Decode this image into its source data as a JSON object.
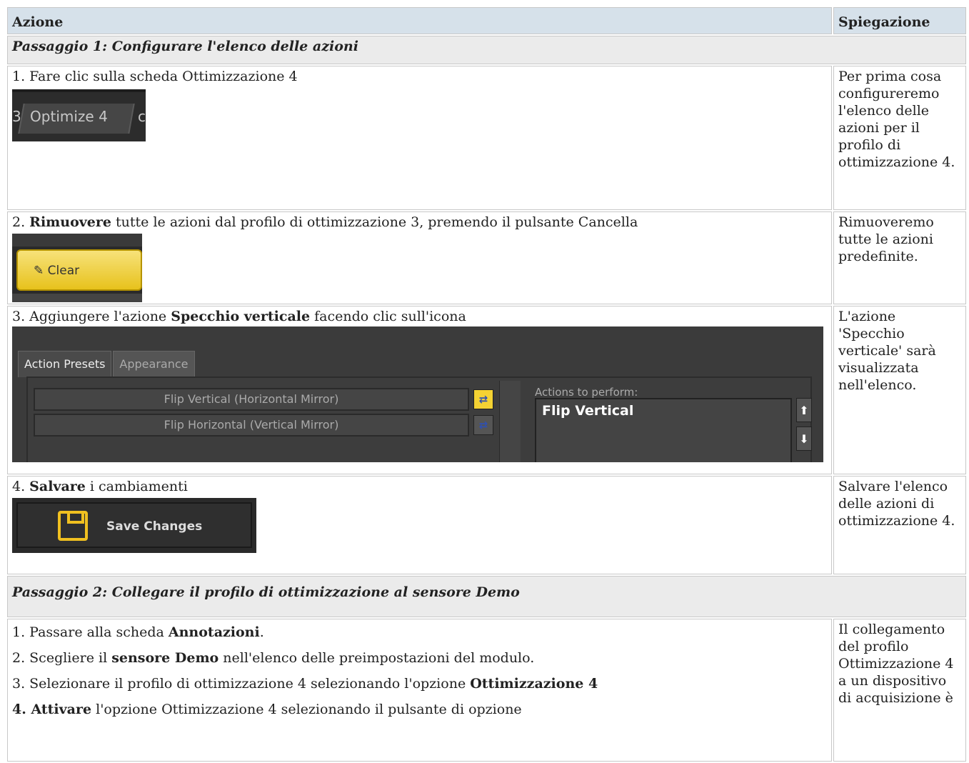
{
  "header": {
    "col1": "Azione",
    "col2": "Spiegazione"
  },
  "section1": {
    "title": "Passaggio 1: Configurare l'elenco delle azioni"
  },
  "step1": {
    "text": "1. Fare clic sulla scheda Ottimizzazione 4",
    "image": {
      "tab_prev": "3",
      "tab_label": "Optimize 4",
      "tab_next": "c"
    },
    "explain": "Per prima cosa configureremo l'elenco delle azioni per il profilo di ottimizzazione 4."
  },
  "step2": {
    "prefix": "2. ",
    "bold": "Rimuovere",
    "suffix": " tutte le azioni dal profilo di ottimizzazione 3, premendo il pulsante Cancella",
    "image": {
      "button_label": "Clear"
    },
    "explain": "Rimuoveremo tutte le azioni predefinite."
  },
  "step3": {
    "prefix": "3. Aggiungere l'azione ",
    "bold": "Specchio verticale",
    "suffix": " facendo clic sull'icona",
    "image": {
      "tab_active": "Action Presets",
      "tab_inactive": "Appearance",
      "items": [
        "Flip Vertical (Horizontal Mirror)",
        "Flip Horizontal (Vertical Mirror)"
      ],
      "actions_label": "Actions to perform:",
      "actions": [
        "Flip Vertical"
      ]
    },
    "explain": "L'azione 'Specchio verticale' sarà visualizzata nell'elenco."
  },
  "step4": {
    "prefix": "4. ",
    "bold": "Salvare",
    "suffix": " i cambiamenti",
    "image": {
      "button_label": "Save Changes"
    },
    "explain": "Salvare l'elenco delle azioni di ottimizzazione 4."
  },
  "section2": {
    "title": "Passaggio 2: Collegare il profilo di ottimizzazione al sensore Demo"
  },
  "step5": {
    "lines": [
      {
        "prefix": "1. Passare alla scheda ",
        "bold": "Annotazioni",
        "suffix": "."
      },
      {
        "prefix": "2. Scegliere il ",
        "bold": "sensore Demo",
        "suffix": " nell'elenco delle preimpostazioni del modulo."
      },
      {
        "prefix": "3. Selezionare il profilo di ottimizzazione 4 selezionando l'opzione ",
        "bold": "Ottimizzazione 4",
        "suffix": ""
      },
      {
        "prefix": "",
        "bold": "4. Attivare",
        "suffix": " l'opzione Ottimizzazione 4 selezionando il pulsante di opzione"
      }
    ],
    "explain": "Il collegamento del profilo Ottimizzazione 4 a un dispositivo di acquisizione è"
  }
}
